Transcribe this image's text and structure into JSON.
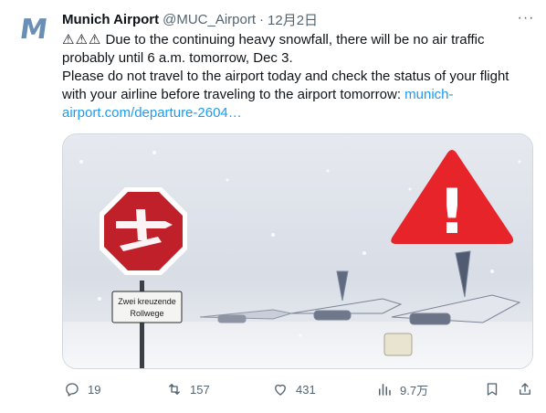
{
  "author": {
    "avatar_mark": "M",
    "name": "Munich Airport",
    "handle": "@MUC_Airport",
    "separator": "·",
    "date": "12月2日",
    "more": "···"
  },
  "tweet": {
    "warnings": [
      "⚠",
      "⚠",
      "⚠"
    ],
    "line1": "Due to the continuing heavy snowfall, there will be no air traffic",
    "line2": "probably until 6 a.m. tomorrow, Dec 3.",
    "line3": "Please do not travel to the airport today and check the status of your flight",
    "line4_text": "with your airline before traveling to the airport tomorrow: ",
    "line4_link": "munich-",
    "line5_link": "airport.com/departure-2604…"
  },
  "media": {
    "sign_text_line1": "Zwei kreuzende",
    "sign_text_line2": "Rollwege",
    "warning_mark": "!",
    "colors": {
      "warning_red": "#e8242b",
      "sign_red": "#c0202a",
      "sky": "#dfe3ea"
    }
  },
  "actions": {
    "replies": "19",
    "retweets": "157",
    "likes": "431",
    "views": "9.7万"
  },
  "icons": [
    "reply-icon",
    "retweet-icon",
    "like-icon",
    "views-icon",
    "bookmark-icon",
    "share-icon",
    "more-icon"
  ],
  "colors": {
    "accent": "#1d9bf0",
    "text": "#0f1419",
    "muted": "#536471",
    "border": "#cfd9de"
  }
}
